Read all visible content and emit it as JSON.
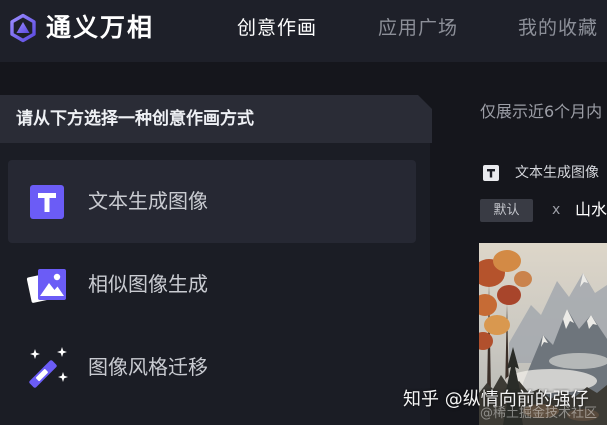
{
  "app": {
    "title": "通义万相",
    "logo_icon": "tongyi-logo-icon"
  },
  "nav": {
    "tabs": [
      {
        "label": "创意作画",
        "active": true
      },
      {
        "label": "应用广场",
        "active": false
      },
      {
        "label": "我的收藏",
        "active": false
      }
    ]
  },
  "sidebar": {
    "heading": "请从下方选择一种创意作画方式",
    "items": [
      {
        "label": "文本生成图像",
        "icon": "text-t-icon",
        "selected": true
      },
      {
        "label": "相似图像生成",
        "icon": "image-icon",
        "selected": false
      },
      {
        "label": "图像风格迁移",
        "icon": "magic-wand-icon",
        "selected": false
      }
    ]
  },
  "history": {
    "notice": "仅展示近6个月内",
    "record": {
      "type_icon": "text-t-icon",
      "type_label": "文本生成图像",
      "style_badge": "默认",
      "separator": "x",
      "prompt": "山水"
    }
  },
  "watermarks": [
    "知乎 @纵情向前的强仔",
    "@稀土掘金技术社区"
  ],
  "colors": {
    "accent": "#6b5cf6",
    "page_background": "#15161c",
    "header_background": "#1e2029",
    "nav_active": "#ffffff",
    "nav_inactive": "#8c8f98"
  }
}
